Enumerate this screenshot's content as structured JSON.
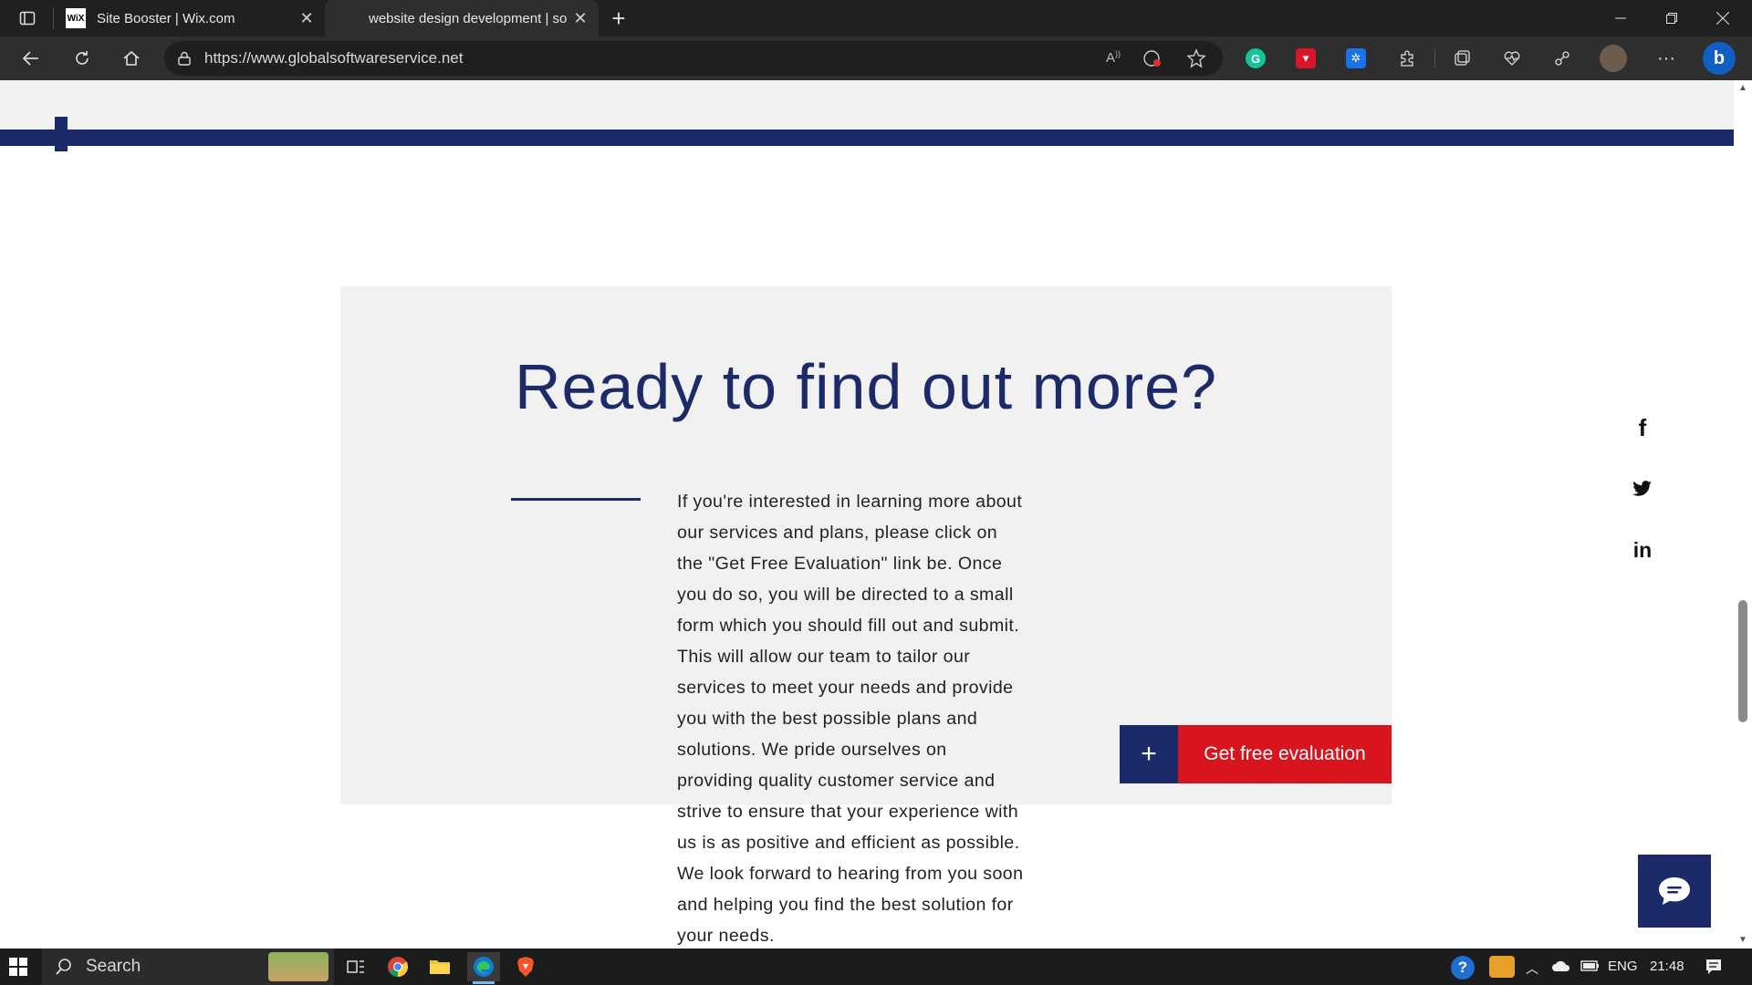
{
  "browser": {
    "tabs": [
      {
        "favicon": "WiX",
        "title": "Site Booster | Wix.com"
      },
      {
        "title": "website design development | so"
      }
    ],
    "url": "https://www.globalsoftwareservice.net",
    "extensions": [
      {
        "name": "grammarly-icon",
        "color": "#15c39a"
      },
      {
        "name": "extension-red-icon",
        "color": "#d9152b"
      },
      {
        "name": "extension-blue-icon",
        "color": "#1a73e8"
      }
    ]
  },
  "page": {
    "heading": "Ready to find out more?",
    "body": "If you're interested in learning more about our services and plans, please click on the \"Get Free Evaluation\" link be. Once you do so, you will be directed to a small form which you should fill out and submit. This will allow our team to tailor our services to meet your needs and provide you with the best possible plans and solutions. We pride ourselves on providing quality customer service and strive to ensure that your experience with us is as positive and efficient as possible. We look forward to hearing from you soon and helping you find the best solution for your needs.",
    "cta": {
      "plus": "+",
      "label": "Get free evaluation"
    },
    "social": [
      {
        "name": "facebook-icon",
        "glyph": "f"
      },
      {
        "name": "twitter-icon"
      },
      {
        "name": "linkedin-icon",
        "glyph": "in"
      }
    ],
    "colors": {
      "brand_navy": "#1d2a6a",
      "cta_red": "#d8141f",
      "card_gray": "#f1f1f1"
    }
  },
  "taskbar": {
    "search_label": "Search",
    "language": "ENG",
    "time": "21:48"
  }
}
